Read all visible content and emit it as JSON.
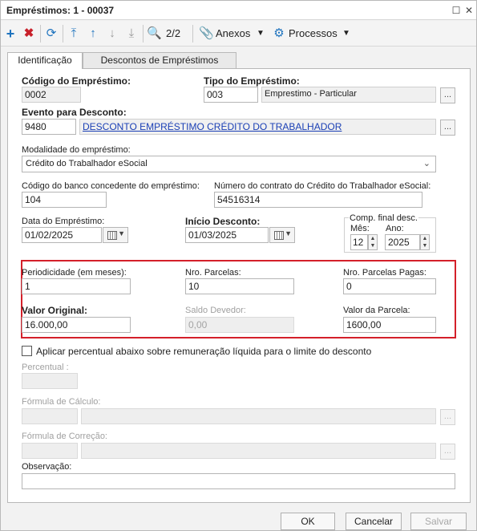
{
  "window": {
    "title": "Empréstimos: 1 - 00037"
  },
  "toolbar": {
    "counter": "2/2",
    "attachments_label": "Anexos",
    "processes_label": "Processos"
  },
  "tabs": [
    {
      "label": "Identificação"
    },
    {
      "label": "Descontos de Empréstimos"
    }
  ],
  "form": {
    "codigo_label": "Código do Empréstimo:",
    "codigo_value": "0002",
    "tipo_label": "Tipo do Empréstimo:",
    "tipo_code": "003",
    "tipo_desc": "Emprestimo - Particular",
    "evento_label": "Evento para Desconto:",
    "evento_code": "9480",
    "evento_desc": "DESCONTO EMPRÉSTIMO CRÉDITO DO TRABALHADOR",
    "modalidade_label": "Modalidade do empréstimo:",
    "modalidade_value": "Crédito do Trabalhador eSocial",
    "banco_label": "Código do banco concedente do empréstimo:",
    "banco_value": "104",
    "contrato_label": "Número do contrato do Crédito do Trabalhador eSocial:",
    "contrato_value": "54516314",
    "data_label": "Data do Empréstimo:",
    "data_value": "01/02/2025",
    "inicio_label": "Início Desconto:",
    "inicio_value": "01/03/2025",
    "comp_label": "Comp. final desc.",
    "mes_label": "Mês:",
    "mes_value": "12",
    "ano_label": "Ano:",
    "ano_value": "2025",
    "periodicidade_label": "Periodicidade (em meses):",
    "periodicidade_value": "1",
    "parcelas_label": "Nro. Parcelas:",
    "parcelas_value": "10",
    "pagas_label": "Nro. Parcelas Pagas:",
    "pagas_value": "0",
    "valor_original_label": "Valor Original:",
    "valor_original_value": "16.000,00",
    "saldo_label": "Saldo Devedor:",
    "saldo_value": "0,00",
    "valor_parcela_label": "Valor da Parcela:",
    "valor_parcela_value": "1600,00",
    "aplicar_label": "Aplicar percentual abaixo sobre remuneração líquida para o limite do desconto",
    "percentual_label": "Percentual :",
    "formula_calculo_label": "Fórmula de Cálculo:",
    "formula_correcao_label": "Fórmula de Correção:",
    "observacao_label": "Observação:"
  },
  "footer": {
    "ok_label": "OK",
    "cancel_label": "Cancelar",
    "save_label": "Salvar"
  },
  "colors": {
    "highlight_box": "#d4202a",
    "link_text": "#1a3fb5",
    "add_icon": "#1e73be",
    "delete_icon": "#c8202a"
  }
}
